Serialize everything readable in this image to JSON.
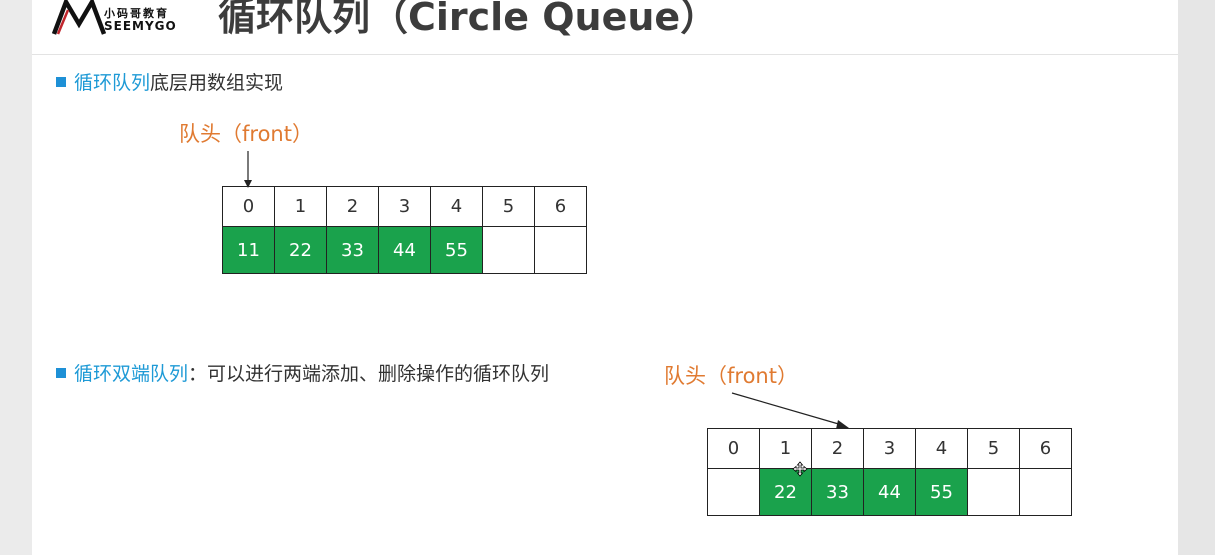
{
  "header": {
    "logo": {
      "cn_text": "小码哥教育",
      "en_text": "SEEMYGO"
    },
    "title": "循环队列（Circle Queue）"
  },
  "section1": {
    "keyword": "循环队列",
    "text": "底层用数组实现",
    "front_label": "队头（front）",
    "array": {
      "indices": [
        "0",
        "1",
        "2",
        "3",
        "4",
        "5",
        "6"
      ],
      "values": [
        "11",
        "22",
        "33",
        "44",
        "55",
        "",
        ""
      ],
      "filled": [
        true,
        true,
        true,
        true,
        true,
        false,
        false
      ],
      "front_index": 0
    }
  },
  "section2": {
    "keyword": "循环双端队列",
    "text": "：可以进行两端添加、删除操作的循环队列",
    "front_label": "队头（front）",
    "array": {
      "indices": [
        "0",
        "1",
        "2",
        "3",
        "4",
        "5",
        "6"
      ],
      "values": [
        "",
        "22",
        "33",
        "44",
        "55",
        "",
        ""
      ],
      "filled": [
        false,
        true,
        true,
        true,
        true,
        false,
        false
      ],
      "front_index": 1
    }
  },
  "colors": {
    "accent_blue": "#1e9ad6",
    "filled_green": "#1aa24c",
    "front_orange": "#e07a31"
  },
  "icons": [
    "logo-m-icon",
    "bullet-square-icon",
    "move-cursor-icon"
  ]
}
